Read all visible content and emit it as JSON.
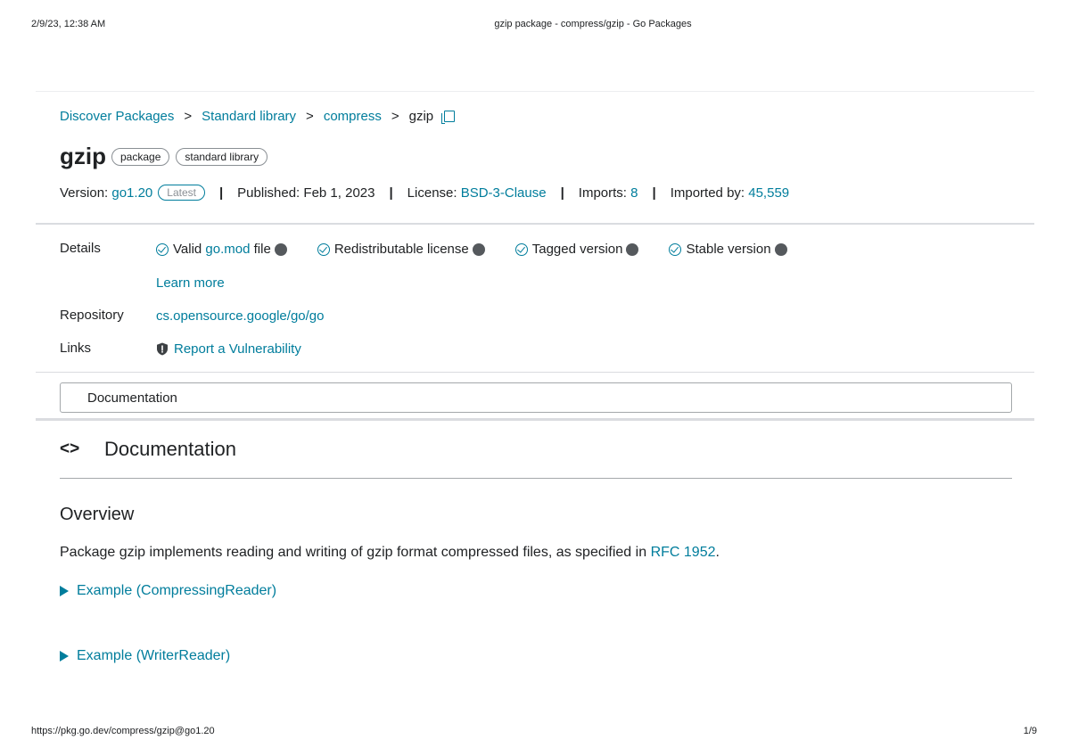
{
  "print_header": {
    "datetime": "2/9/23, 12:38 AM",
    "doc_title": "gzip package - compress/gzip - Go Packages"
  },
  "breadcrumb": {
    "items": [
      "Discover Packages",
      "Standard library",
      "compress"
    ],
    "separator": ">",
    "current": "gzip",
    "copy_icon": "copy-icon"
  },
  "package": {
    "name": "gzip",
    "chips": [
      "package",
      "standard library"
    ]
  },
  "meta": {
    "version_label": "Version:",
    "version": "go1.20",
    "latest_badge": "Latest",
    "separator": "|",
    "published_label": "Published:",
    "published": "Feb 1, 2023",
    "license_label": "License:",
    "license": "BSD-3-Clause",
    "imports_label": "Imports:",
    "imports": "8",
    "imported_by_label": "Imported by:",
    "imported_by": "45,559"
  },
  "details": {
    "label": "Details",
    "valid_prefix": "Valid",
    "valid_link": "go.mod",
    "valid_suffix": "file",
    "redistributable": "Redistributable license",
    "tagged": "Tagged version",
    "stable": "Stable version",
    "learn_more": "Learn more"
  },
  "repository": {
    "label": "Repository",
    "url": "cs.opensource.google/go/go"
  },
  "links": {
    "label": "Links",
    "report": "Report a Vulnerability"
  },
  "nav": {
    "documentation_tab": "Documentation"
  },
  "documentation": {
    "icon": "<>",
    "title": "Documentation",
    "overview_title": "Overview",
    "overview_text": "Package gzip implements reading and writing of gzip format compressed files, as specified in",
    "rfc_link": "RFC 1952",
    "overview_end": ".",
    "examples": [
      "Example (CompressingReader)",
      "Example (WriterReader)"
    ]
  },
  "print_footer": {
    "url": "https://pkg.go.dev/compress/gzip@go1.20",
    "page": "1/9"
  },
  "colors": {
    "link": "#007d9c",
    "text": "#202224",
    "divider": "#dadce0"
  }
}
